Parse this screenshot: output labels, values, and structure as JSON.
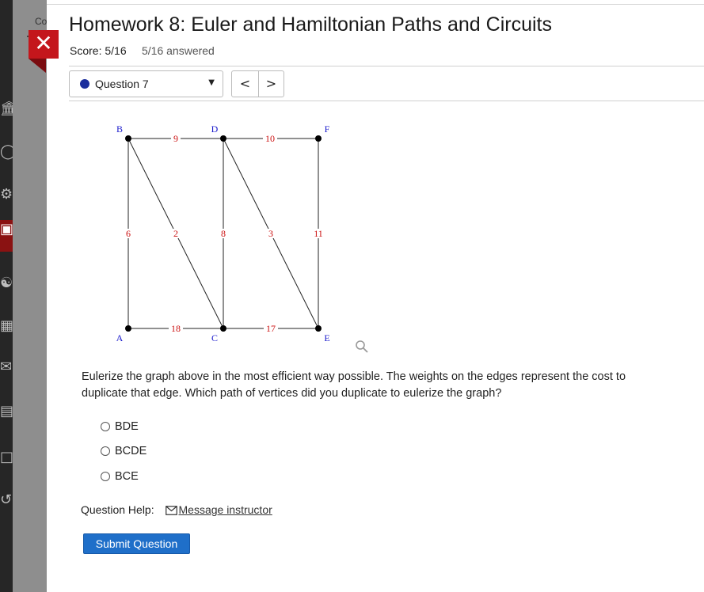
{
  "header": {
    "title": "Homework 8: Euler and Hamiltonian Paths and Circuits",
    "score": "Score: 5/16",
    "answered": "5/16 answered",
    "close_label": "✕",
    "course_fragment": "Co"
  },
  "nav": {
    "question_label": "Question 7",
    "prev_label": "<",
    "next_label": ">"
  },
  "graph": {
    "vertices": [
      {
        "id": "B",
        "label": "B"
      },
      {
        "id": "D",
        "label": "D"
      },
      {
        "id": "F",
        "label": "F"
      },
      {
        "id": "A",
        "label": "A"
      },
      {
        "id": "C",
        "label": "C"
      },
      {
        "id": "E",
        "label": "E"
      }
    ],
    "edges": [
      {
        "from": "B",
        "to": "D",
        "weight": "9"
      },
      {
        "from": "D",
        "to": "F",
        "weight": "10"
      },
      {
        "from": "B",
        "to": "A",
        "weight": "6"
      },
      {
        "from": "B",
        "to": "C",
        "weight": "2"
      },
      {
        "from": "D",
        "to": "C",
        "weight": "8"
      },
      {
        "from": "D",
        "to": "E",
        "weight": "3"
      },
      {
        "from": "F",
        "to": "E",
        "weight": "11"
      },
      {
        "from": "A",
        "to": "C",
        "weight": "18"
      },
      {
        "from": "C",
        "to": "E",
        "weight": "17"
      }
    ],
    "vertex_label_color": "#1a1acc",
    "weight_label_color": "#cc1111"
  },
  "question": {
    "text": "Eulerize the graph above in the most efficient way possible. The weights on the edges represent the cost to duplicate that edge. Which path of vertices did you duplicate to eulerize the graph?",
    "options": [
      "BDE",
      "BCDE",
      "BCE"
    ]
  },
  "help": {
    "label": "Question Help:",
    "link": "Message instructor"
  },
  "submit_label": "Submit Question",
  "colors": {
    "accent": "#1f6fc9",
    "close_red": "#c4161c",
    "question_dot": "#1b2e9c"
  }
}
